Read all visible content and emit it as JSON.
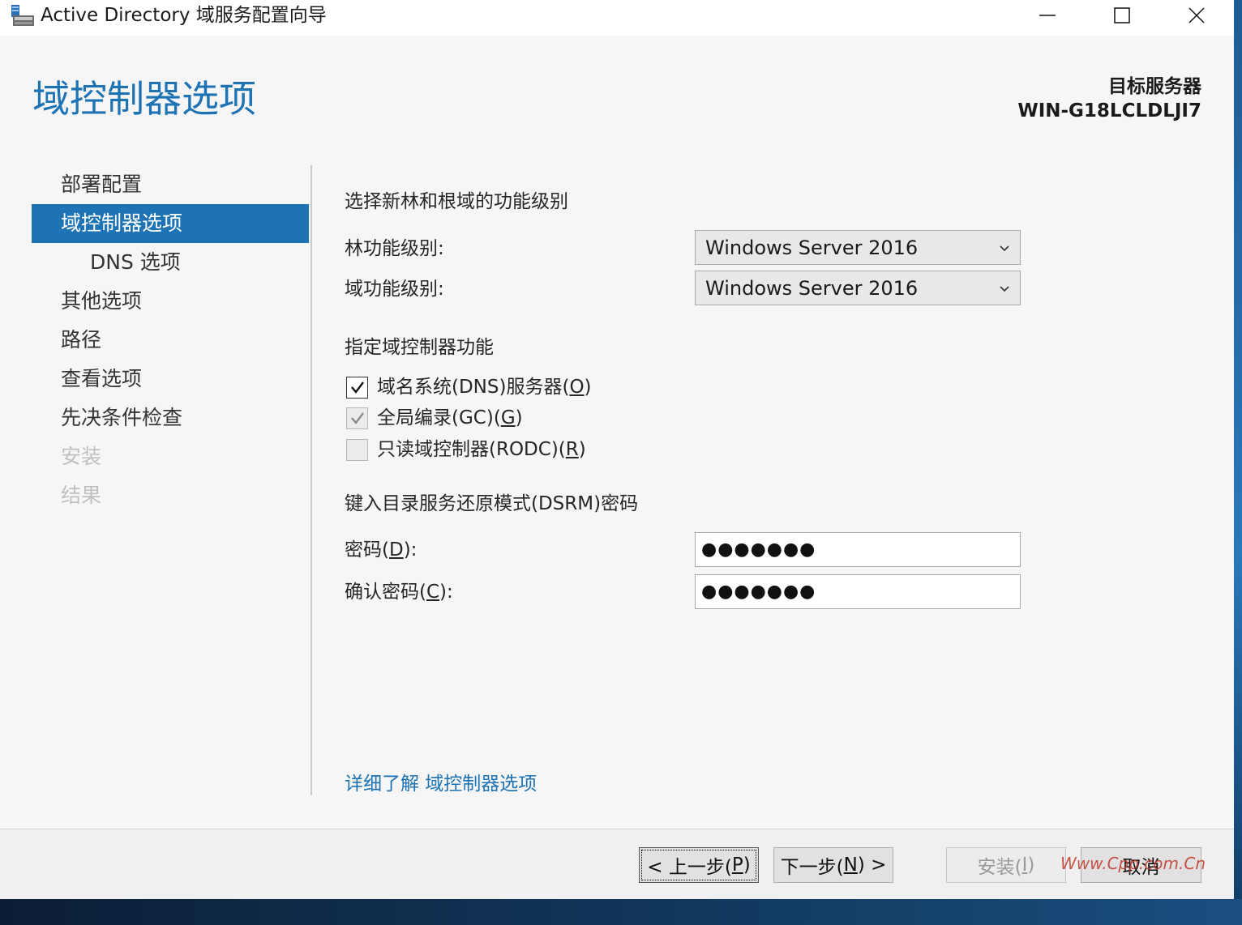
{
  "window": {
    "title": "Active Directory 域服务配置向导"
  },
  "header": {
    "page_title": "域控制器选项",
    "target_label": "目标服务器",
    "target_name": "WIN-G18LCLDLJI7"
  },
  "nav": {
    "items": [
      {
        "label": "部署配置",
        "state": "normal"
      },
      {
        "label": "域控制器选项",
        "state": "active"
      },
      {
        "label": "DNS 选项",
        "state": "sub"
      },
      {
        "label": "其他选项",
        "state": "normal"
      },
      {
        "label": "路径",
        "state": "normal"
      },
      {
        "label": "查看选项",
        "state": "normal"
      },
      {
        "label": "先决条件检查",
        "state": "normal"
      },
      {
        "label": "安装",
        "state": "disabled"
      },
      {
        "label": "结果",
        "state": "disabled"
      }
    ]
  },
  "content": {
    "functional_title": "选择新林和根域的功能级别",
    "forest_label": "林功能级别:",
    "forest_value": "Windows Server 2016",
    "domain_label": "域功能级别:",
    "domain_value": "Windows Server 2016",
    "capabilities_title": "指定域控制器功能",
    "dns_label_pre": "域名系统(DNS)服务器(",
    "dns_key": "O",
    "dns_label_post": ")",
    "gc_label_pre": "全局编录(GC)(",
    "gc_key": "G",
    "gc_label_post": ")",
    "rodc_label_pre": "只读域控制器(RODC)(",
    "rodc_key": "R",
    "rodc_label_post": ")",
    "dsrm_title": "键入目录服务还原模式(DSRM)密码",
    "password_label_pre": "密码(",
    "password_key": "D",
    "password_label_post": "):",
    "password_mask": "●●●●●●●",
    "confirm_label_pre": "确认密码(",
    "confirm_key": "C",
    "confirm_label_post": "):",
    "confirm_mask": "●●●●●●●",
    "learn_more": "详细了解 域控制器选项"
  },
  "footer": {
    "back_pre": "< 上一步(",
    "back_key": "P",
    "back_post": ")",
    "next_pre": "下一步(",
    "next_key": "N",
    "next_post": ") >",
    "install_pre": "安装(",
    "install_key": "I",
    "install_post": ")",
    "cancel": "取消"
  },
  "watermark": "Www.Cpp.com.Cn",
  "colors": {
    "accent": "#1d73b4"
  }
}
